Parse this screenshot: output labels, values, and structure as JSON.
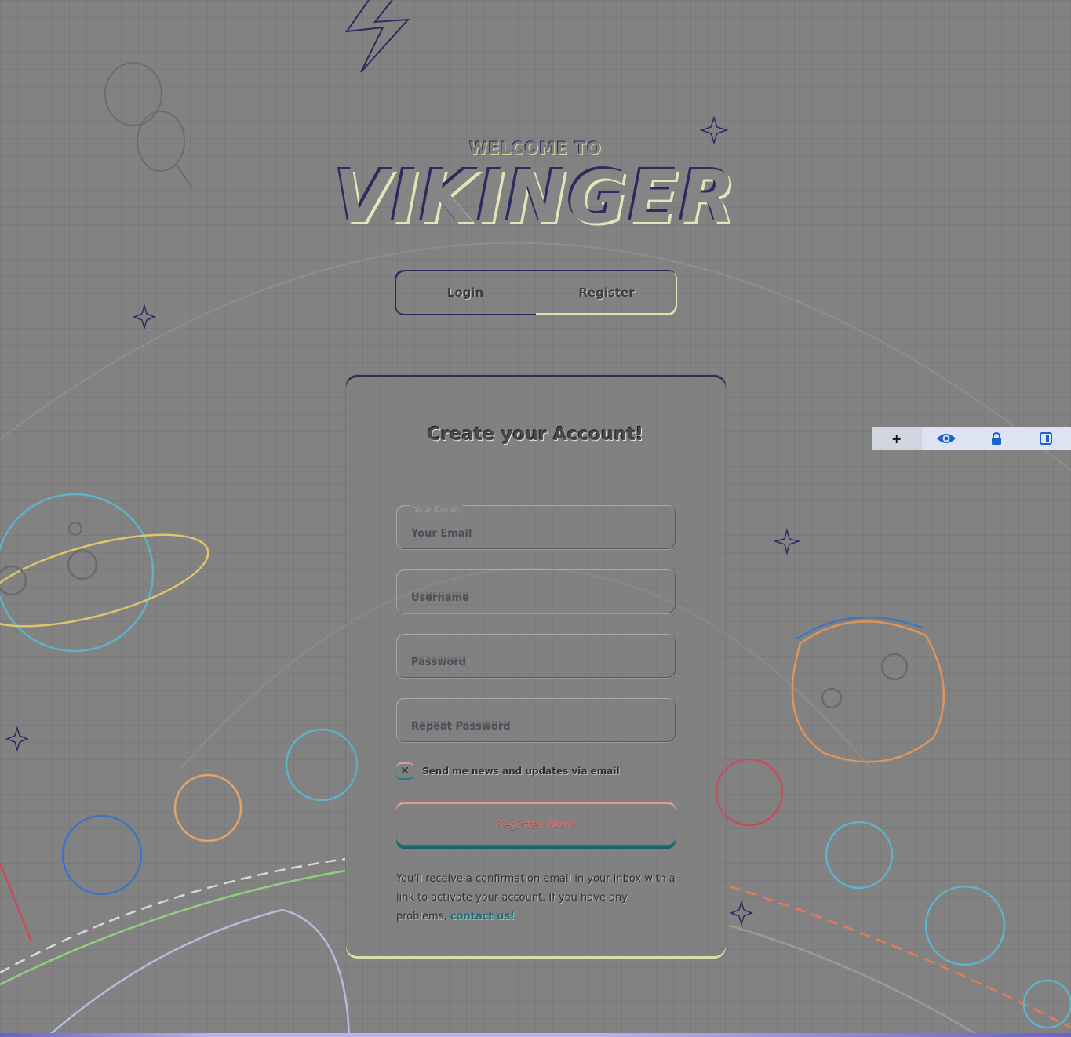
{
  "header": {
    "welcome": "WELCOME TO",
    "logo": "VIKINGER"
  },
  "tabs": [
    {
      "label": "Login"
    },
    {
      "label": "Register"
    }
  ],
  "form": {
    "title": "Create your Account!",
    "email": {
      "label": "Your Email",
      "placeholder": "Your Email"
    },
    "username": {
      "placeholder": "Username"
    },
    "password": {
      "placeholder": "Password"
    },
    "repeat_password": {
      "placeholder": "Repeat Password"
    },
    "newsletter": {
      "label": "Send me news and updates via email",
      "checked": true
    },
    "submit_label": "Register Now!",
    "note_text": "You'll receive a confirmation email in your inbox with a link to activate your account. If you have any problems,",
    "note_link": "contact us!"
  },
  "toolbar": {
    "plus": "+",
    "icons": [
      "eye-icon",
      "lock-icon",
      "panel-icon"
    ]
  }
}
